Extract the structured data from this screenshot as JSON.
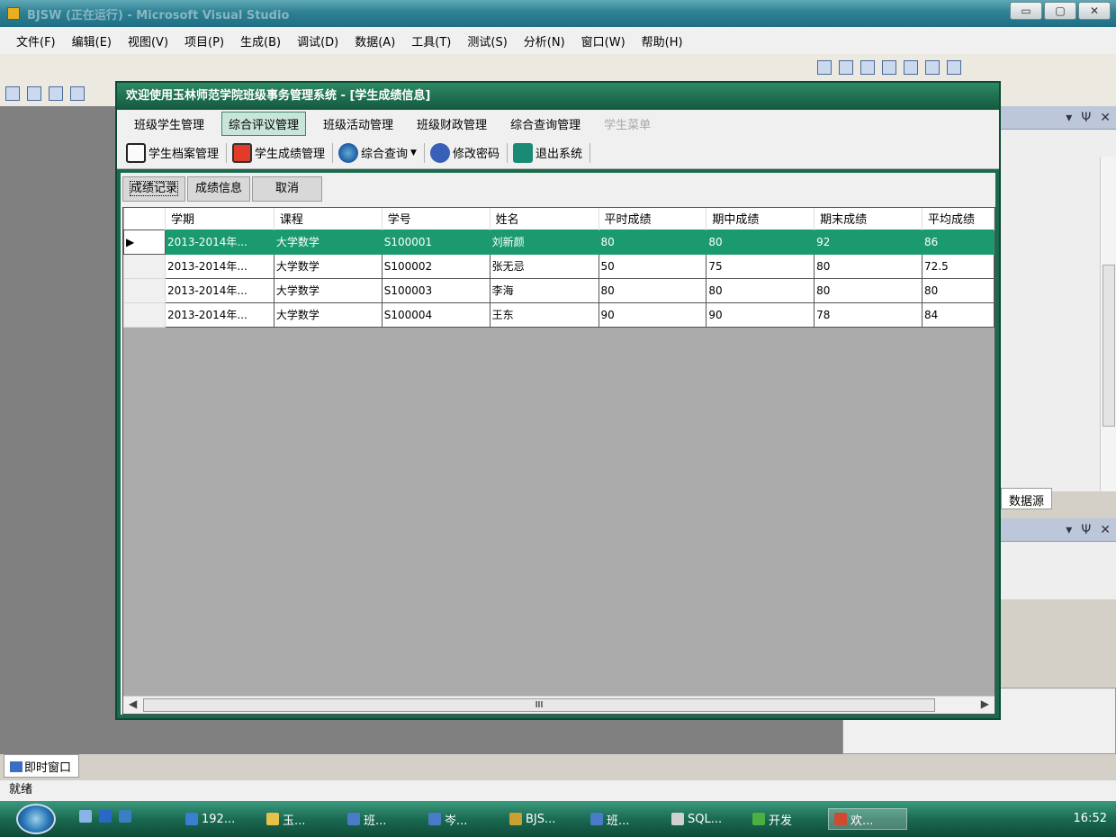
{
  "vs": {
    "title": "BJSW (正在运行) - Microsoft Visual Studio",
    "window_buttons": [
      "▭",
      "▢",
      "✕"
    ],
    "menu": [
      "文件(F)",
      "编辑(E)",
      "视图(V)",
      "项目(P)",
      "生成(B)",
      "调试(D)",
      "数据(A)",
      "工具(T)",
      "测试(S)",
      "分析(N)",
      "窗口(W)",
      "帮助(H)"
    ],
    "right_panel_tab": "数据源",
    "right_panel_controls": [
      "▾",
      "Ψ",
      "✕"
    ],
    "immediate_tab": "即时窗口",
    "status": "就绪"
  },
  "app": {
    "title": "欢迎使用玉林师范学院班级事务管理系统 - [学生成绩信息]",
    "menu": [
      {
        "label": "班级学生管理",
        "state": "normal"
      },
      {
        "label": "综合评议管理",
        "state": "active"
      },
      {
        "label": "班级活动管理",
        "state": "normal"
      },
      {
        "label": "班级财政管理",
        "state": "normal"
      },
      {
        "label": "综合查询管理",
        "state": "normal"
      },
      {
        "label": "学生菜单",
        "state": "disabled"
      }
    ],
    "toolbar": [
      {
        "label": "学生档案管理",
        "icon": "folder-icon"
      },
      {
        "label": "学生成绩管理",
        "icon": "book-icon"
      },
      {
        "label": "综合查询",
        "icon": "globe-icon",
        "dropdown": true
      },
      {
        "label": "修改密码",
        "icon": "key-icon"
      },
      {
        "label": "退出系统",
        "icon": "exit-icon"
      }
    ],
    "buttons": {
      "records": "成绩记录",
      "info": "成绩信息",
      "cancel": "取消"
    },
    "grid": {
      "columns": [
        "学期",
        "课程",
        "学号",
        "姓名",
        "平时成绩",
        "期中成绩",
        "期末成绩",
        "平均成绩"
      ],
      "rows": [
        [
          "2013-2014年...",
          "大学数学",
          "S100001",
          "刘新颜",
          "80",
          "80",
          "92",
          "86"
        ],
        [
          "2013-2014年...",
          "大学数学",
          "S100002",
          "张无忌",
          "50",
          "75",
          "80",
          "72.5"
        ],
        [
          "2013-2014年...",
          "大学数学",
          "S100003",
          "李海",
          "80",
          "80",
          "80",
          "80"
        ],
        [
          "2013-2014年...",
          "大学数学",
          "S100004",
          "王东",
          "90",
          "90",
          "78",
          "84"
        ]
      ],
      "selected_row": 0,
      "scroll_label": "III"
    }
  },
  "taskbar": {
    "items": [
      {
        "label": "192...",
        "color": "#3a7fd0"
      },
      {
        "label": "玉...",
        "color": "#e6c24a"
      },
      {
        "label": "班...",
        "color": "#4a7ac8"
      },
      {
        "label": "岑...",
        "color": "#4a7ac8"
      },
      {
        "label": "BJS...",
        "color": "#c8a030"
      },
      {
        "label": "班...",
        "color": "#4a7ac8"
      },
      {
        "label": "SQL...",
        "color": "#d0d0d0"
      },
      {
        "label": "开发",
        "color": "#4ab040"
      },
      {
        "label": "欢...",
        "color": "#d04a30"
      }
    ],
    "clock": "16:52"
  }
}
